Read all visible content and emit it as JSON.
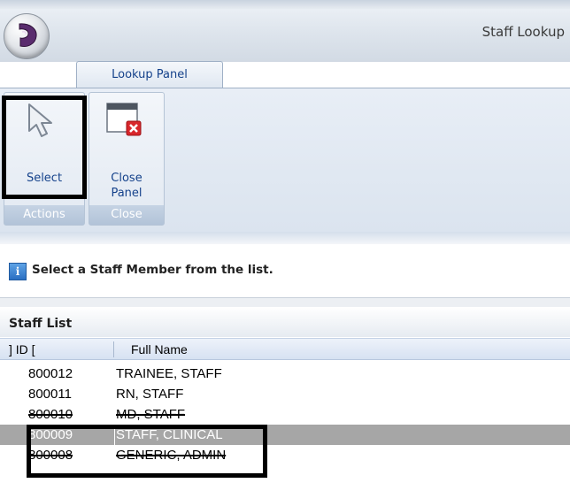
{
  "window": {
    "title": "Staff Lookup"
  },
  "tabs": [
    {
      "label": "Lookup Panel"
    }
  ],
  "ribbon": {
    "groups": [
      {
        "label": "Actions",
        "buttons": [
          {
            "label": "Select",
            "icon": "cursor-arrow-icon"
          }
        ]
      },
      {
        "label": "Close",
        "buttons": [
          {
            "label_line1": "Close",
            "label_line2": "Panel",
            "icon": "close-window-icon"
          }
        ]
      }
    ]
  },
  "info": {
    "icon": "info-icon",
    "glyph": "i",
    "text": "Select a Staff Member from the list."
  },
  "staff_list": {
    "title": "Staff List",
    "columns": {
      "id": "] ID [",
      "name": "Full Name"
    },
    "rows": [
      {
        "id": "800012",
        "name": "TRAINEE, STAFF",
        "selected": false
      },
      {
        "id": "800011",
        "name": "RN, STAFF",
        "selected": false
      },
      {
        "id": "800010",
        "name": "MD, STAFF",
        "selected": false
      },
      {
        "id": "800009",
        "name": "STAFF, CLINICAL",
        "selected": true
      },
      {
        "id": "800008",
        "name": "GENERIC, ADMIN",
        "selected": false
      }
    ]
  },
  "colors": {
    "selected_row": "#a6a6a6",
    "ribbon_text": "#15428b",
    "highlight_border": "#000000"
  }
}
